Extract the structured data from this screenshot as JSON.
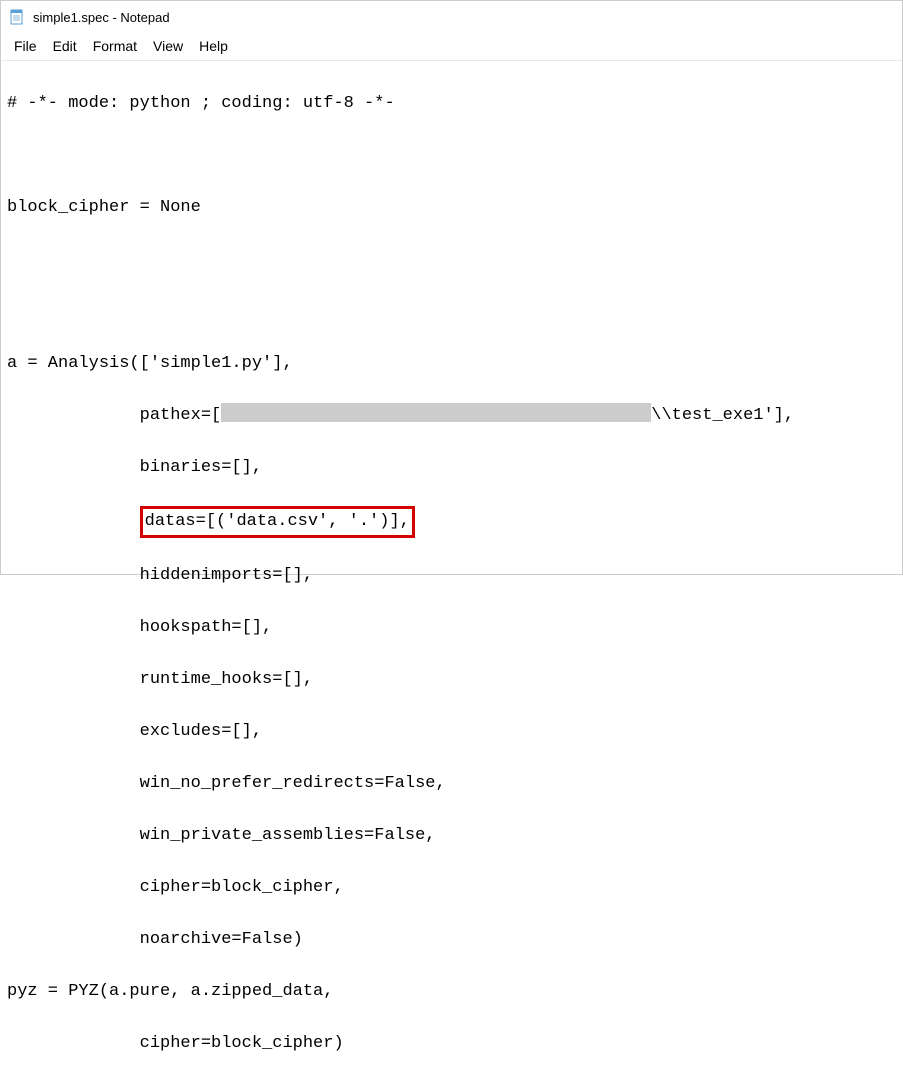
{
  "window": {
    "title": "simple1.spec - Notepad"
  },
  "menu": {
    "file": "File",
    "edit": "Edit",
    "format": "Format",
    "view": "View",
    "help": "Help"
  },
  "content": {
    "line1": "# -*- mode: python ; coding: utf-8 -*-",
    "line2": "",
    "line3": "block_cipher = None",
    "line4": "",
    "line5": "",
    "line6": "a = Analysis(['simple1.py'],",
    "line7_pre": "             pathex=[",
    "line7_post": "\\\\test_exe1'],",
    "line8": "             binaries=[],",
    "line9_pre": "             ",
    "line9_highlight": "datas=[('data.csv', '.')],",
    "line10": "             hiddenimports=[],",
    "line11": "             hookspath=[],",
    "line12": "             runtime_hooks=[],",
    "line13": "             excludes=[],",
    "line14": "             win_no_prefer_redirects=False,",
    "line15": "             win_private_assemblies=False,",
    "line16": "             cipher=block_cipher,",
    "line17": "             noarchive=False)",
    "line18": "pyz = PYZ(a.pure, a.zipped_data,",
    "line19": "             cipher=block_cipher)"
  }
}
